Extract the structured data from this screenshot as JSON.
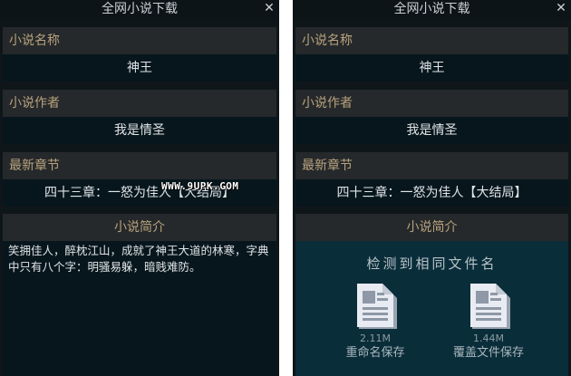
{
  "window": {
    "title": "全网小说下载",
    "close_glyph": "✕"
  },
  "fields": {
    "name": {
      "label": "小说名称",
      "value": "神王"
    },
    "author": {
      "label": "小说作者",
      "value": "我是情圣"
    },
    "latest": {
      "label": "最新章节",
      "value": "四十三章：一怒为佳人【大结局】"
    },
    "intro": {
      "label": "小说简介",
      "text": "笑拥佳人，醉枕江山，成就了神王大道的林寒，字典中只有八个字：明骚易躲，暗贱难防。"
    }
  },
  "watermark": "WWW.9UPK.COM",
  "dialog": {
    "title": "检测到相同文件名",
    "options": [
      {
        "size": "2.11M",
        "label": "重命名保存",
        "icon": "document-icon"
      },
      {
        "size": "1.44M",
        "label": "覆盖文件保存",
        "icon": "document-icon"
      }
    ]
  },
  "colors": {
    "panel_bg": "#0f1619",
    "label_bg": "#25292b",
    "label_text": "#b9a27e",
    "value_bg": "#07161d",
    "dialog_bg": "#0a2d3a"
  }
}
